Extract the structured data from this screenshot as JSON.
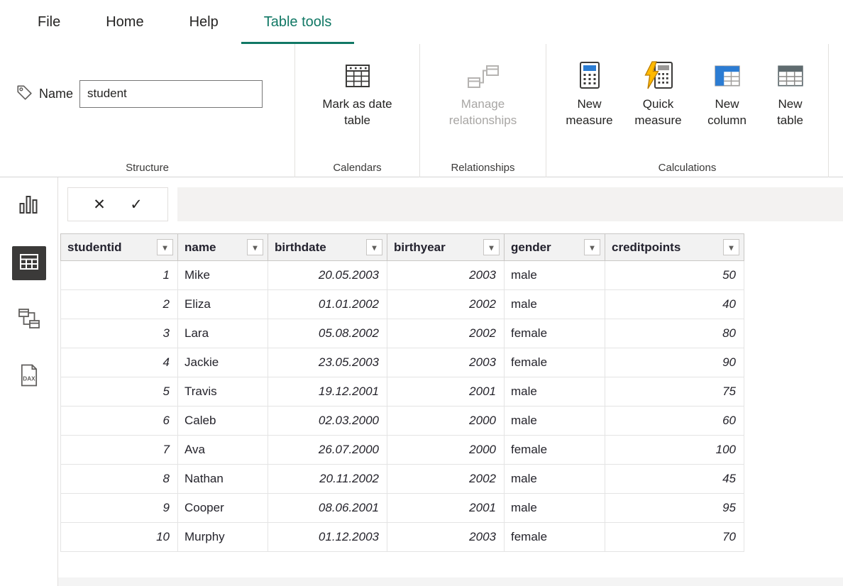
{
  "tabs": [
    {
      "label": "File",
      "active": false
    },
    {
      "label": "Home",
      "active": false
    },
    {
      "label": "Help",
      "active": false
    },
    {
      "label": "Table tools",
      "active": true
    }
  ],
  "ribbon": {
    "structure": {
      "group_label": "Structure",
      "name_label": "Name",
      "name_value": "student"
    },
    "calendars": {
      "group_label": "Calendars",
      "mark_as_date_table": "Mark as date table"
    },
    "relationships": {
      "group_label": "Relationships",
      "manage_relationships": "Manage relationships",
      "manage_relationships_disabled": true
    },
    "calculations": {
      "group_label": "Calculations",
      "new_measure": "New measure",
      "quick_measure": "Quick measure",
      "new_column": "New column",
      "new_table": "New table"
    }
  },
  "sidebar": {
    "views": [
      "report-view",
      "data-view",
      "model-view",
      "dax-query-view"
    ],
    "active_view": "data-view",
    "dax_label": "DAX"
  },
  "icons": {
    "cancel": "✕",
    "commit": "✓",
    "dropdown": "▾"
  },
  "colors": {
    "accent_teal": "#117865",
    "active_view_bg": "#3b3a39",
    "disabled_gray": "#a8a6a4",
    "header_bg": "#f2f2f2"
  },
  "table": {
    "columns": [
      {
        "label": "studentid",
        "type": "number"
      },
      {
        "label": "name",
        "type": "text"
      },
      {
        "label": "birthdate",
        "type": "date"
      },
      {
        "label": "birthyear",
        "type": "number"
      },
      {
        "label": "gender",
        "type": "text"
      },
      {
        "label": "creditpoints",
        "type": "number"
      }
    ],
    "rows": [
      [
        "1",
        "Mike",
        "20.05.2003",
        "2003",
        "male",
        "50"
      ],
      [
        "2",
        "Eliza",
        "01.01.2002",
        "2002",
        "male",
        "40"
      ],
      [
        "3",
        "Lara",
        "05.08.2002",
        "2002",
        "female",
        "80"
      ],
      [
        "4",
        "Jackie",
        "23.05.2003",
        "2003",
        "female",
        "90"
      ],
      [
        "5",
        "Travis",
        "19.12.2001",
        "2001",
        "male",
        "75"
      ],
      [
        "6",
        "Caleb",
        "02.03.2000",
        "2000",
        "male",
        "60"
      ],
      [
        "7",
        "Ava",
        "26.07.2000",
        "2000",
        "female",
        "100"
      ],
      [
        "8",
        "Nathan",
        "20.11.2002",
        "2002",
        "male",
        "45"
      ],
      [
        "9",
        "Cooper",
        "08.06.2001",
        "2001",
        "male",
        "95"
      ],
      [
        "10",
        "Murphy",
        "01.12.2003",
        "2003",
        "female",
        "70"
      ]
    ]
  }
}
